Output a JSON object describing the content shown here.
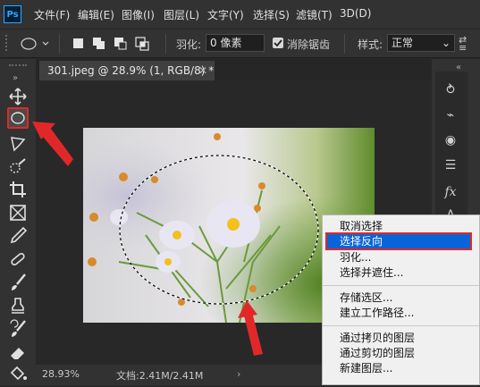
{
  "app": {
    "logo": "Ps"
  },
  "menu": {
    "items": [
      "文件(F)",
      "编辑(E)",
      "图像(I)",
      "图层(L)",
      "文字(Y)",
      "选择(S)",
      "滤镜(T)",
      "3D(D)"
    ]
  },
  "options": {
    "feather_label": "羽化:",
    "feather_value": "0 像素",
    "antialias_label": "消除锯齿",
    "antialias_checked": true,
    "style_label": "样式:",
    "style_value": "正常"
  },
  "document": {
    "tab_title": "301.jpeg @ 28.9% (1, RGB/8) *"
  },
  "status": {
    "zoom": "28.93%",
    "doc_size": "文档:2.41M/2.41M"
  },
  "context_menu": {
    "items": [
      "取消选择",
      "选择反向",
      "羽化...",
      "选择并遮住...",
      "存储选区...",
      "建立工作路径...",
      "通过拷贝的图层",
      "通过剪切的图层",
      "新建图层..."
    ],
    "highlighted": "选择反向"
  },
  "colors": {
    "highlight": "#0a64d8",
    "annotation": "#e02828"
  },
  "icons": [
    "move-icon",
    "elliptical-marquee-icon",
    "lasso-icon",
    "quick-select-icon",
    "crop-icon",
    "frame-icon",
    "eyedropper-icon",
    "healing-icon",
    "brush-icon",
    "stamp-icon",
    "history-brush-icon",
    "eraser-icon",
    "paint-bucket-icon"
  ]
}
